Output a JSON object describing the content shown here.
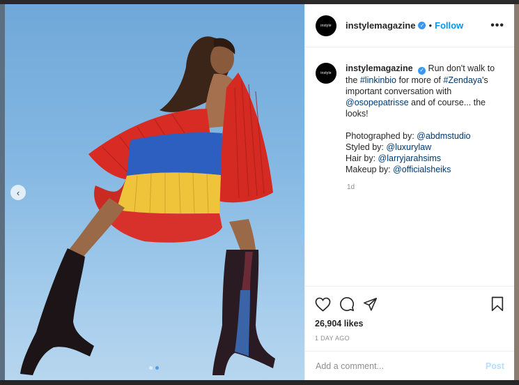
{
  "post": {
    "account": "instyle",
    "username": "instylemagazine",
    "follow_label": "Follow",
    "separator": "•",
    "more_glyph": "•••",
    "caption": {
      "line_intro": "Run don't walk to the ",
      "hashtag_linkinbio": "#linkinbio",
      "line_mid": " for more of ",
      "hashtag_zendaya": "#Zendaya",
      "line_mid2": "'s important conversation with ",
      "mention_oso": "@osopepatrisse",
      "line_end": " and of course... the looks!",
      "credits": [
        {
          "label": "Photographed by: ",
          "handle": "@abdmstudio"
        },
        {
          "label": "Styled by: ",
          "handle": "@luxurylaw"
        },
        {
          "label": "Hair by: ",
          "handle": "@larryjarahsims"
        },
        {
          "label": "Makeup by: ",
          "handle": "@officialsheiks"
        }
      ],
      "time": "1d"
    },
    "likes": "26,904 likes",
    "posted_ago": "1 DAY AGO",
    "comment_placeholder": "Add a comment...",
    "post_label": "Post",
    "carousel": {
      "prev_glyph": "‹",
      "slide_count": 2,
      "active_slide": 2
    }
  },
  "icons": [
    "heart-icon",
    "comment-icon",
    "share-icon",
    "bookmark-icon",
    "verified-icon",
    "chevron-left-icon"
  ],
  "colors": {
    "link": "#00376b",
    "follow": "#0095f6",
    "verified": "#3897f0",
    "post_disabled": "#b2dffc"
  }
}
